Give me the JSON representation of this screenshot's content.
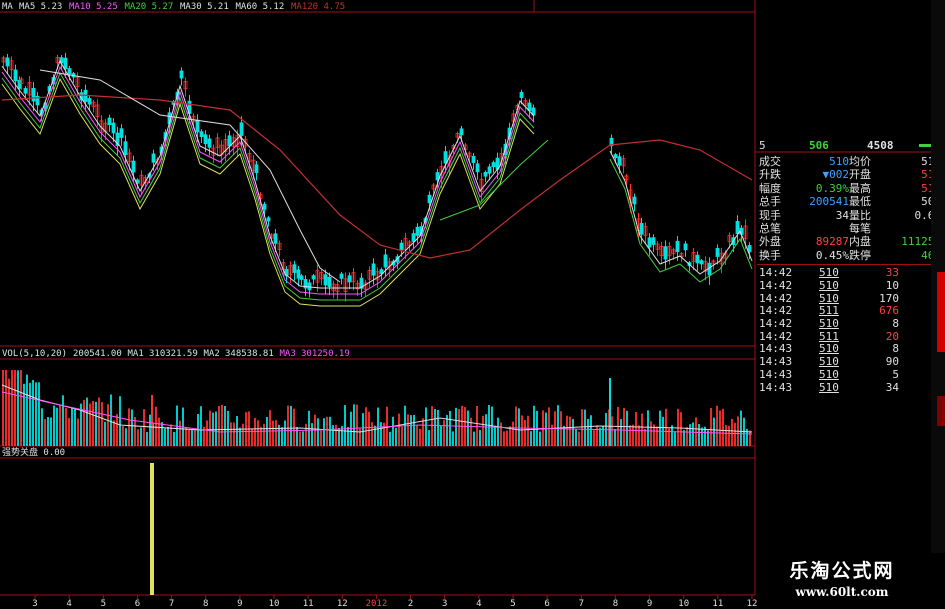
{
  "legend": {
    "items": [
      {
        "text": "MA",
        "color": "#e0e0e0"
      },
      {
        "text": "MA5 5.23",
        "color": "#e0e0e0"
      },
      {
        "text": "MA10 5.25",
        "color": "#ff55ff"
      },
      {
        "text": "MA20 5.27",
        "color": "#40d040"
      },
      {
        "text": "MA30 5.21",
        "color": "#e0e0e0"
      },
      {
        "text": "MA60 5.12",
        "color": "#e0e0e0"
      },
      {
        "text": "MA120 4.75",
        "color": "#c03030"
      }
    ]
  },
  "vol_header": {
    "items": [
      {
        "text": "VOL(5,10,20)",
        "color": "#e0e0e0"
      },
      {
        "text": "200541.00",
        "color": "#e0e0e0"
      },
      {
        "text": "MA1",
        "color": "#e0e0e0"
      },
      {
        "text": "310321.59",
        "color": "#e0e0e0"
      },
      {
        "text": "MA2",
        "color": "#e0e0e0"
      },
      {
        "text": "348538.81",
        "color": "#e0e0e0"
      },
      {
        "text": "MA3",
        "color": "#ff55ff"
      },
      {
        "text": "301250.19",
        "color": "#ff55ff"
      }
    ]
  },
  "indicator": {
    "label": "强势关盘 0.00"
  },
  "xaxis": {
    "labels": [
      "3",
      "4",
      "5",
      "6",
      "7",
      "8",
      "9",
      "10",
      "11",
      "12",
      "2012",
      "2",
      "3",
      "4",
      "5",
      "6",
      "7",
      "8",
      "9",
      "10",
      "11",
      "12"
    ],
    "year_label": "2012"
  },
  "quote": {
    "top": {
      "left": "5",
      "mid": "506",
      "right": "4508"
    },
    "rows": [
      {
        "k1": "成交",
        "v1": "510",
        "k2": "均价",
        "v2": "510",
        "c1": "#40a0ff",
        "c2": "#e0e0e0"
      },
      {
        "k1": "升跌",
        "v1": "▼002",
        "k2": "开盘",
        "v2": "511",
        "c1": "#40a0ff",
        "c2": "#ff4040"
      },
      {
        "k1": "幅度",
        "v1": "0.39%",
        "k2": "最高",
        "v2": "515",
        "c1": "#40d040",
        "c2": "#ff4040"
      },
      {
        "k1": "总手",
        "v1": "200541",
        "k2": "最低",
        "v2": "508",
        "c1": "#40a0ff",
        "c2": "#e0e0e0"
      },
      {
        "k1": "现手",
        "v1": "34",
        "k2": "量比",
        "v2": "0.65",
        "c1": "#e0e0e0",
        "c2": "#e0e0e0"
      },
      {
        "k1": "总笔",
        "v1": "",
        "k2": "每笔",
        "v2": "",
        "c1": "#e0e0e0",
        "c2": "#e0e0e0"
      },
      {
        "k1": "外盘",
        "v1": "89287",
        "k2": "内盘",
        "v2": "111254",
        "c1": "#ff4040",
        "c2": "#40d040"
      },
      {
        "k1": "换手",
        "v1": "0.45%",
        "k2": "跌停",
        "v2": "461",
        "c1": "#e0e0e0",
        "c2": "#40d040"
      }
    ],
    "trades": [
      {
        "time": "14:42",
        "price": "510",
        "vol": "33",
        "vc": "#ff4040"
      },
      {
        "time": "14:42",
        "price": "510",
        "vol": "10",
        "vc": "#e0e0e0"
      },
      {
        "time": "14:42",
        "price": "510",
        "vol": "170",
        "vc": "#e0e0e0"
      },
      {
        "time": "14:42",
        "price": "511",
        "vol": "676",
        "vc": "#ff4040"
      },
      {
        "time": "14:42",
        "price": "510",
        "vol": "8",
        "vc": "#e0e0e0"
      },
      {
        "time": "14:42",
        "price": "511",
        "vol": "20",
        "vc": "#ff4040"
      },
      {
        "time": "14:43",
        "price": "510",
        "vol": "8",
        "vc": "#e0e0e0"
      },
      {
        "time": "14:43",
        "price": "510",
        "vol": "90",
        "vc": "#e0e0e0"
      },
      {
        "time": "14:43",
        "price": "510",
        "vol": "5",
        "vc": "#e0e0e0"
      },
      {
        "time": "14:43",
        "price": "510",
        "vol": "34",
        "vc": "#e0e0e0"
      }
    ]
  },
  "watermark": {
    "title": "乐淘公式网",
    "url": "www.60lt.com"
  },
  "colors": {
    "up": "#ff3030",
    "down": "#00e0e0",
    "frame": "#a01010",
    "signal": "#e0e060"
  }
}
